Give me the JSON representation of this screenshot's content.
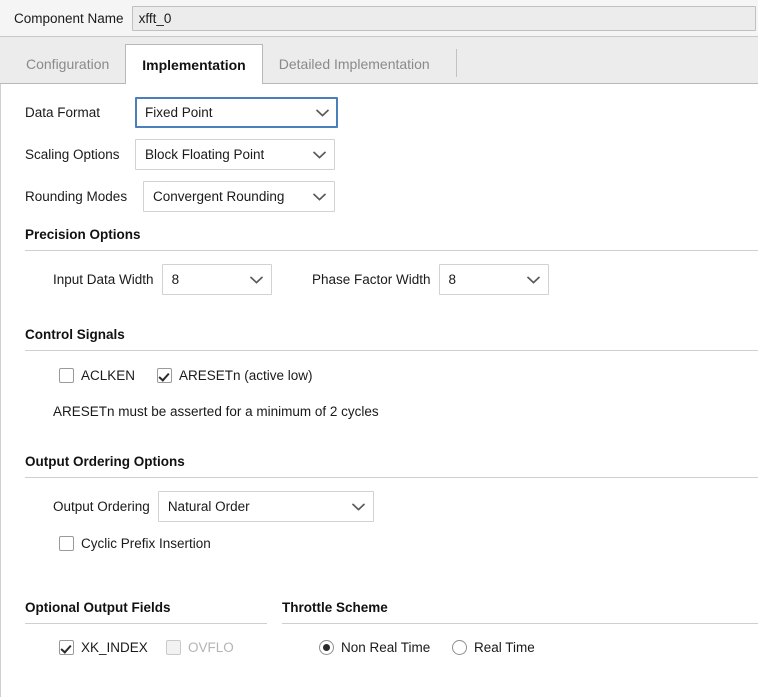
{
  "component_name": {
    "label": "Component Name",
    "value": "xfft_0"
  },
  "tabs": [
    {
      "label": "Configuration",
      "active": false
    },
    {
      "label": "Implementation",
      "active": true
    },
    {
      "label": "Detailed Implementation",
      "active": false
    }
  ],
  "top_settings": [
    {
      "label": "Data Format",
      "value": "Fixed Point",
      "focused": true
    },
    {
      "label": "Scaling Options",
      "value": "Block Floating Point",
      "focused": false
    },
    {
      "label": "Rounding Modes",
      "value": "Convergent Rounding",
      "focused": false
    }
  ],
  "precision_options": {
    "title": "Precision Options",
    "input_data_width": {
      "label": "Input Data Width",
      "value": "8"
    },
    "phase_factor_width": {
      "label": "Phase Factor Width",
      "value": "8"
    }
  },
  "control_signals": {
    "title": "Control Signals",
    "aclken": {
      "label": "ACLKEN",
      "checked": false
    },
    "aresetn": {
      "label": "ARESETn (active low)",
      "checked": true
    },
    "note": "ARESETn must be asserted for a minimum of 2 cycles"
  },
  "output_ordering_options": {
    "title": "Output Ordering Options",
    "output_ordering": {
      "label": "Output Ordering",
      "value": "Natural Order"
    },
    "cyclic_prefix": {
      "label": "Cyclic Prefix Insertion",
      "checked": false
    }
  },
  "optional_output_fields": {
    "title": "Optional Output Fields",
    "xk_index": {
      "label": "XK_INDEX",
      "checked": true,
      "disabled": false
    },
    "ovflo": {
      "label": "OVFLO",
      "checked": false,
      "disabled": true
    }
  },
  "throttle_scheme": {
    "title": "Throttle Scheme",
    "options": [
      {
        "label": "Non Real Time",
        "selected": true
      },
      {
        "label": "Real Time",
        "selected": false
      }
    ]
  },
  "colors": {
    "focus_border": "#4a7ebd",
    "panel_bg": "#ffffff",
    "chrome_bg": "#ececec",
    "rule": "#cfcfcf"
  },
  "icons": {
    "chevron_down": "chevron-down-icon"
  }
}
